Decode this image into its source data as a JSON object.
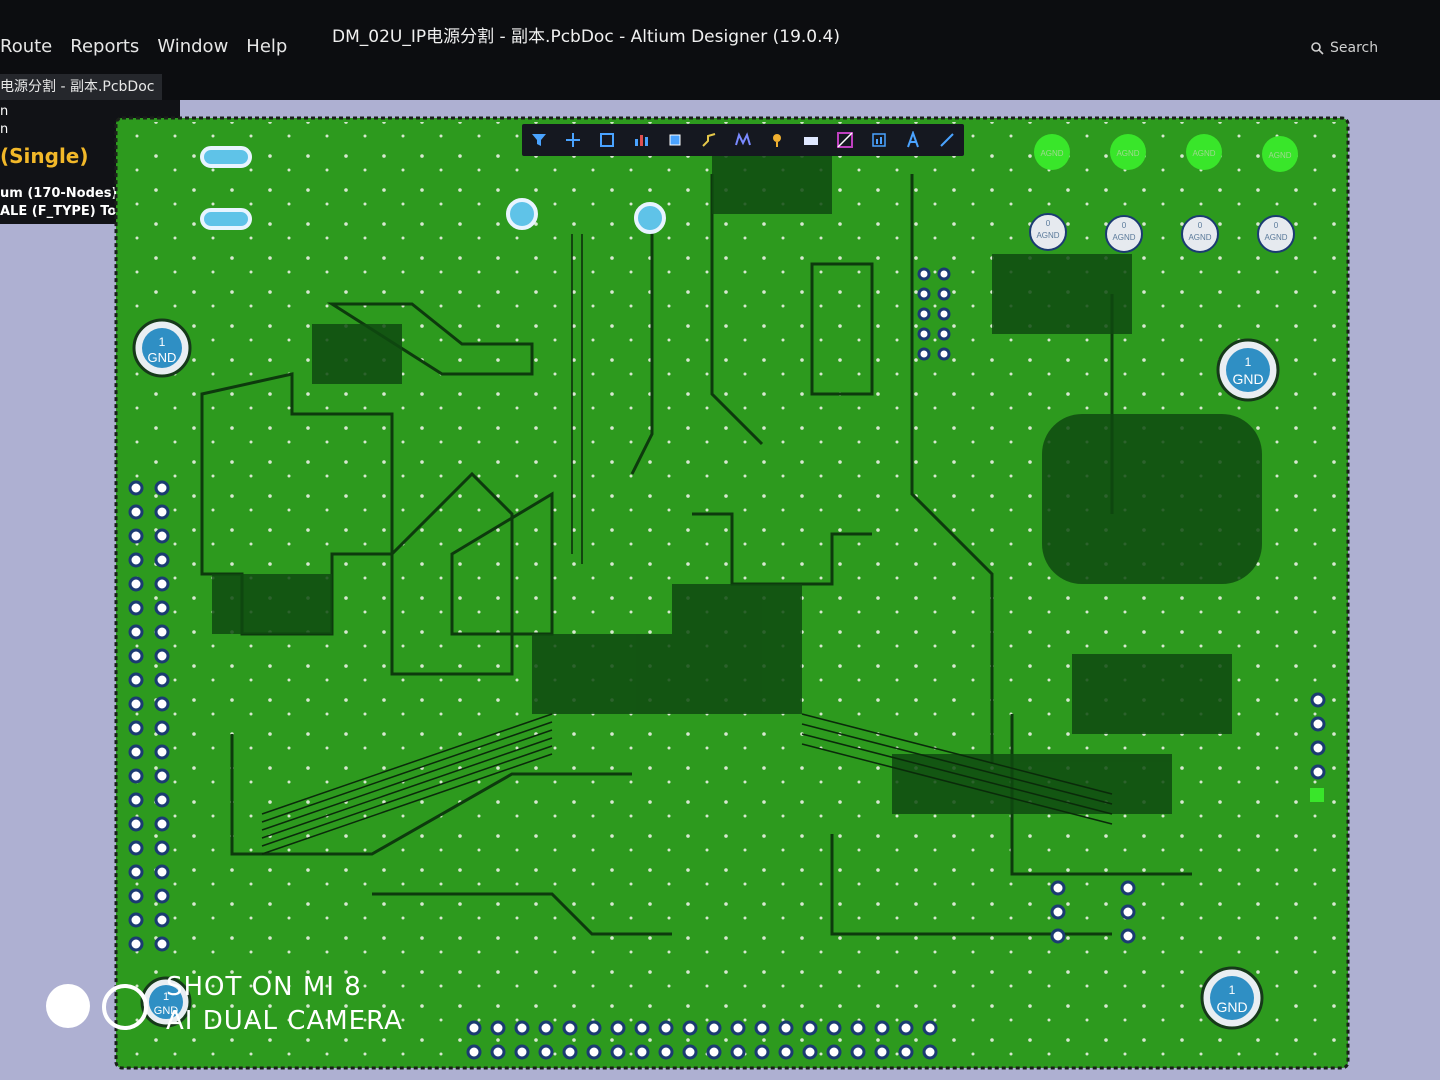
{
  "window": {
    "title": "DM_02U_IP电源分割 - 副本.PcbDoc - Altium Designer (19.0.4)",
    "menu": [
      "Route",
      "Reports",
      "Window",
      "Help"
    ],
    "search_label": "Search",
    "doc_tab": "电源分割 - 副本.PcbDoc"
  },
  "side_panel": {
    "lines": [
      "n",
      "n"
    ],
    "mode": "(Single)",
    "net_info": "um (170-Nodes)",
    "layer_info": "ALE (F_TYPE) Top Layer"
  },
  "pcb": {
    "board_color": "#2d9a1e",
    "copper_dark": "#0d3a0d",
    "bg_color": "#aeb0d2",
    "gnd_markers": [
      {
        "number": "1",
        "net": "GND"
      },
      {
        "number": "1",
        "net": "GND"
      },
      {
        "number": "1",
        "net": "GND"
      },
      {
        "number": "1",
        "net": "GND"
      }
    ],
    "agnd_pads_green": [
      "AGND",
      "AGND",
      "AGND",
      "AGND"
    ],
    "agnd_pads_white": [
      {
        "number": "0",
        "net": "AGND"
      },
      {
        "number": "0",
        "net": "AGND"
      },
      {
        "number": "0",
        "net": "AGND"
      },
      {
        "number": "0",
        "net": "AGND"
      }
    ]
  },
  "toolbar_icons": [
    "filter-icon",
    "crosshair-icon",
    "select-rect-icon",
    "chart-icon",
    "chip-icon",
    "route-icon",
    "interactive-route-icon",
    "pin-icon",
    "component-icon",
    "dimension-icon",
    "report-icon",
    "text-icon",
    "line-icon"
  ],
  "watermark": {
    "line1": "SHOT ON MI 8",
    "line2": "AI DUAL CAMERA"
  }
}
